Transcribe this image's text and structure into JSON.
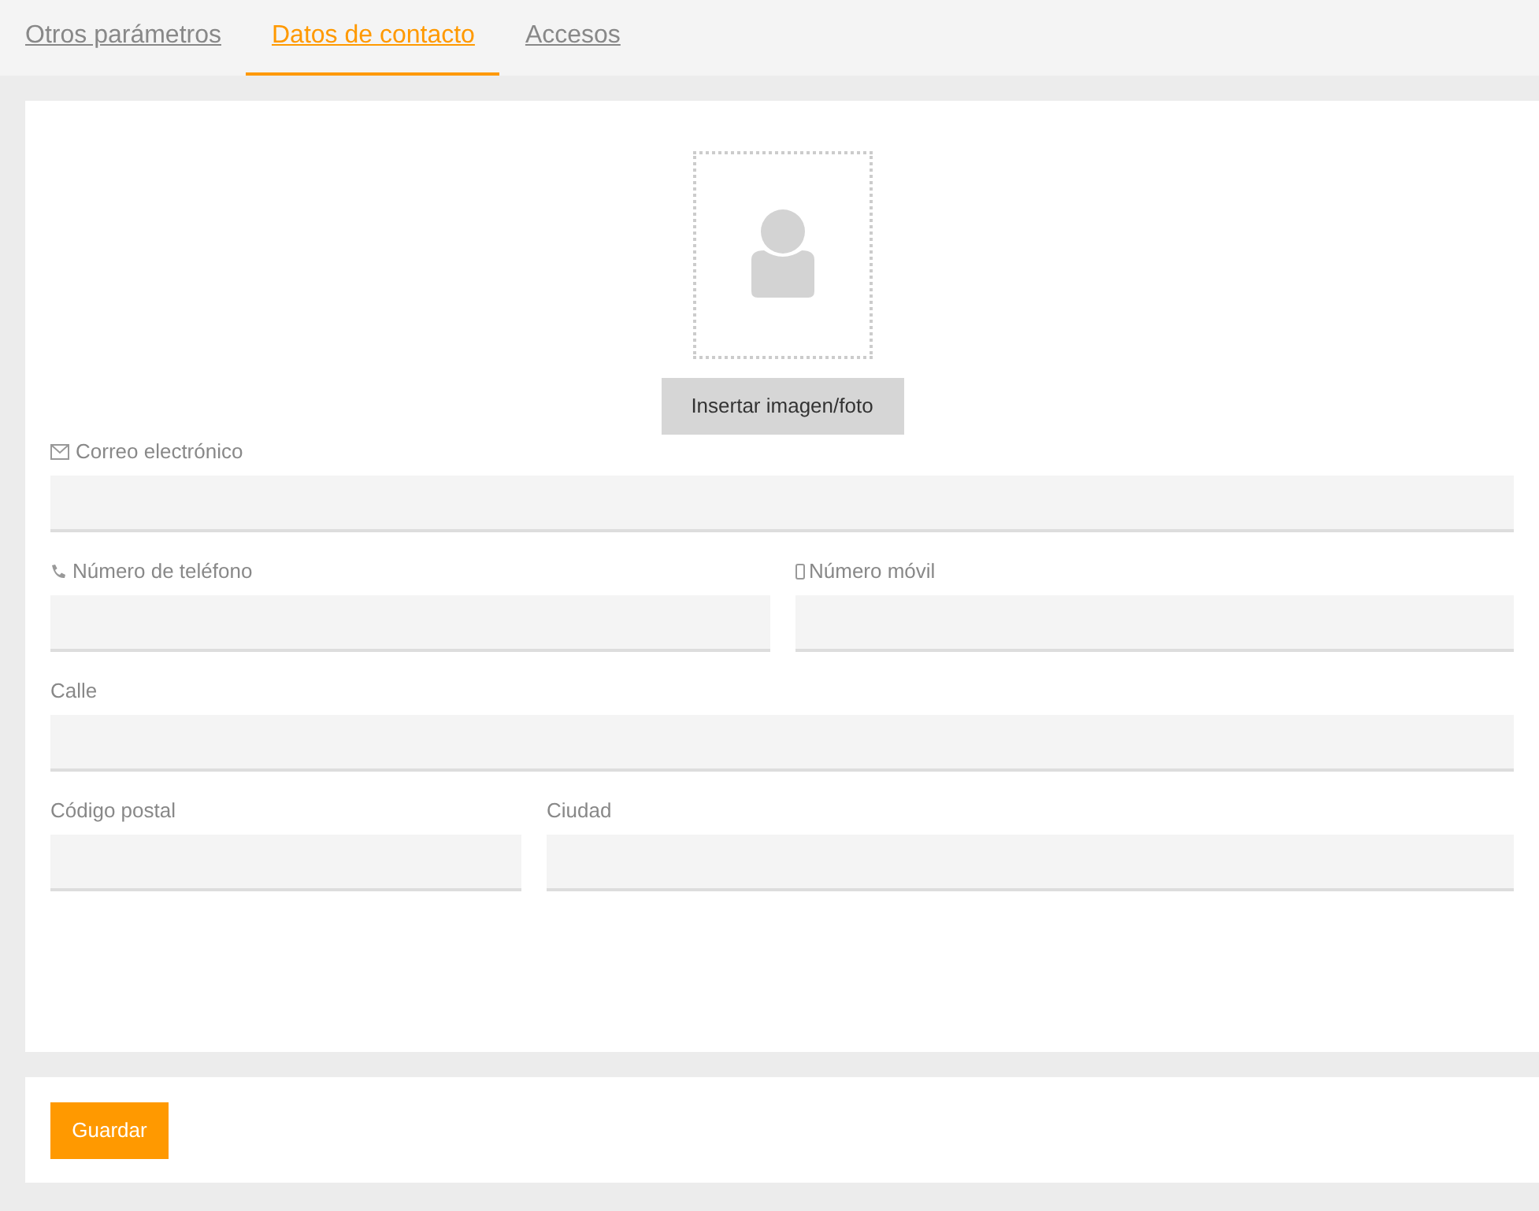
{
  "tabs": [
    {
      "label": "Otros parámetros",
      "selected": false
    },
    {
      "label": "Datos de contacto",
      "selected": true
    },
    {
      "label": "Accesos",
      "selected": false
    }
  ],
  "photo": {
    "button": "Insertar imagen/foto"
  },
  "rows": [
    {
      "kind": "full",
      "fields": [
        {
          "label": "Correo electrónico",
          "kind": "email"
        }
      ]
    },
    {
      "kind": "halves",
      "fields": [
        {
          "label": "Número de teléfono",
          "kind": "phone"
        },
        {
          "label": "Número móvil",
          "kind": "mobile"
        }
      ]
    },
    {
      "kind": "full",
      "fields": [
        {
          "label": "Calle",
          "kind": "text"
        }
      ]
    },
    {
      "kind": "narrow-wide",
      "fields": [
        {
          "label": "Código postal",
          "kind": "text"
        },
        {
          "label": "Ciudad",
          "kind": "text"
        }
      ]
    }
  ],
  "save_button": "Guardar"
}
